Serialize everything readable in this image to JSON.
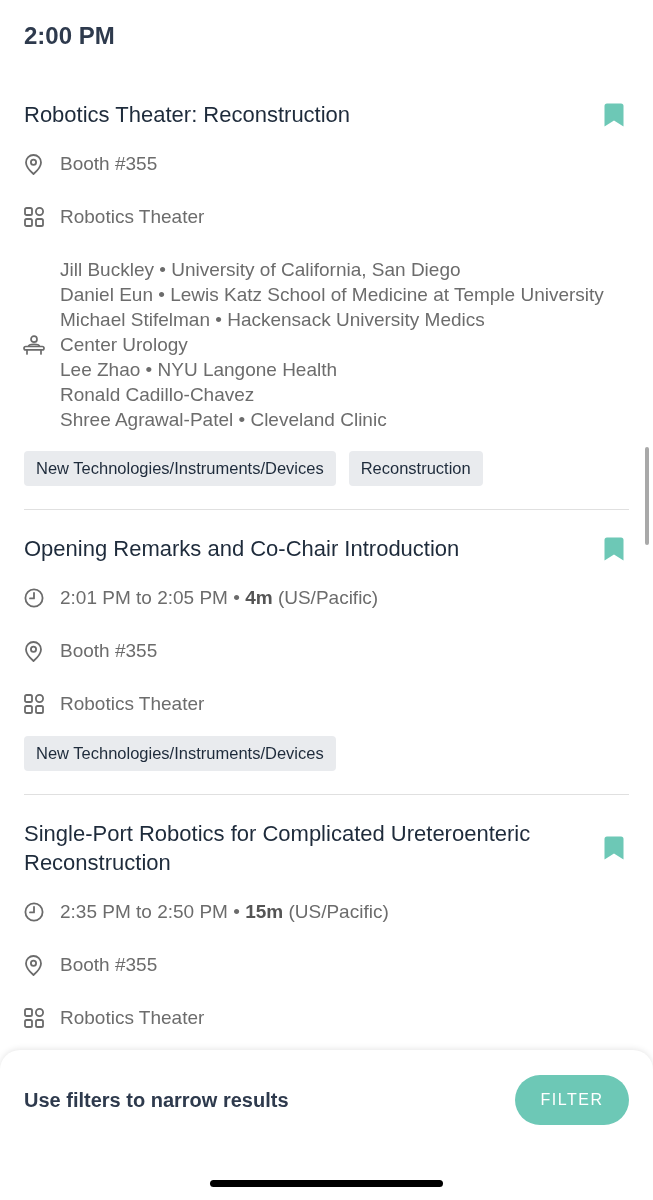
{
  "time_header": "2:00 PM",
  "sessions": [
    {
      "title": "Robotics Theater: Reconstruction",
      "bookmarked": true,
      "details": [
        {
          "kind": "location",
          "text": "Booth #355"
        },
        {
          "kind": "room",
          "text": "Robotics Theater"
        },
        {
          "kind": "speakers",
          "lines": [
            "Jill Buckley • University of California, San Diego",
            "Daniel Eun • Lewis Katz School of Medicine at Temple University",
            "Michael Stifelman • Hackensack University Medics",
            "Center Urology",
            "Lee Zhao • NYU Langone Health",
            "Ronald Cadillo-Chavez",
            "Shree Agrawal-Patel • Cleveland Clinic"
          ]
        }
      ],
      "tags": [
        "New Technologies/Instruments/Devices",
        "Reconstruction"
      ]
    },
    {
      "title": "Opening Remarks and Co-Chair Introduction",
      "bookmarked": true,
      "details": [
        {
          "kind": "time",
          "text": "2:01 PM to 2:05 PM • **4m** (US/Pacific)"
        },
        {
          "kind": "location",
          "text": "Booth #355"
        },
        {
          "kind": "room",
          "text": "Robotics Theater"
        }
      ],
      "tags": [
        "New Technologies/Instruments/Devices"
      ]
    },
    {
      "title": "Single-Port Robotics for Complicated Ureteroenteric Reconstruction",
      "bookmarked": true,
      "details": [
        {
          "kind": "time",
          "text": "2:35 PM to 2:50 PM • **15m** (US/Pacific)"
        },
        {
          "kind": "location",
          "text": "Booth #355"
        },
        {
          "kind": "room",
          "text": "Robotics Theater"
        }
      ]
    }
  ],
  "filter_bar": {
    "message": "Use filters to narrow results",
    "button": "FILTER"
  }
}
